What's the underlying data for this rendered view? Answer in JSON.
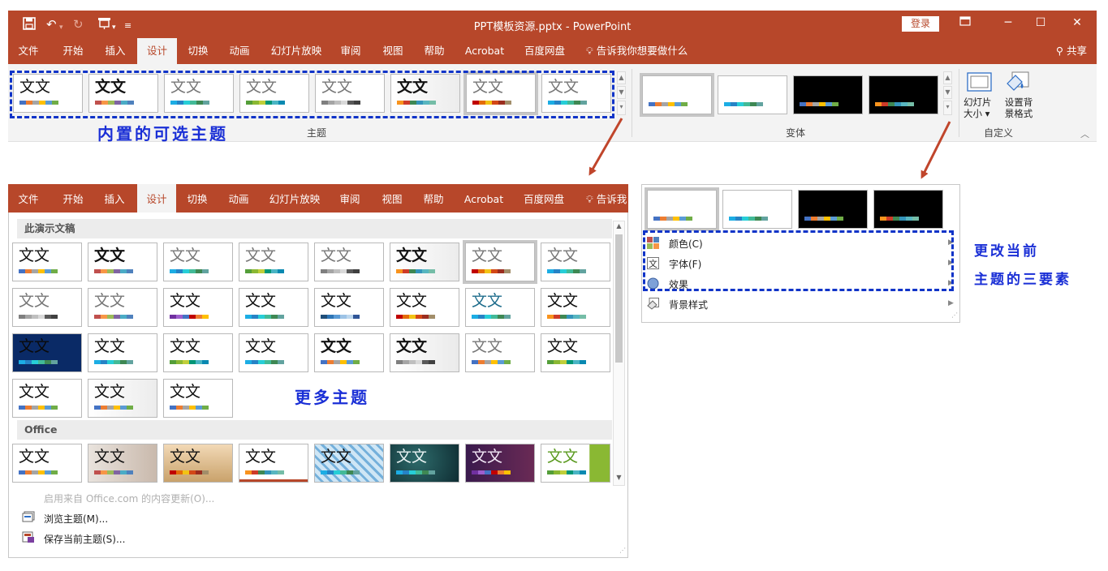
{
  "window": {
    "title": "PPT模板资源.pptx  -  PowerPoint",
    "login": "登录",
    "share": "共享",
    "quick_access": [
      "save-icon",
      "undo-icon",
      "redo-icon",
      "present-icon",
      "customize-icon"
    ]
  },
  "tabs": [
    "文件",
    "开始",
    "插入",
    "设计",
    "切换",
    "动画",
    "幻灯片放映",
    "审阅",
    "视图",
    "帮助",
    "Acrobat",
    "百度网盘"
  ],
  "active_tab": "设计",
  "tell_me": "告诉我你想要做什么",
  "tell_me_short": "告诉我",
  "ribbon": {
    "group_themes": "主题",
    "group_variants": "变体",
    "group_customize": "自定义",
    "slide_size": "幻灯片大小",
    "format_bg": "设置背景格式"
  },
  "thumb_text": "文文",
  "gallery": {
    "section_current": "此演示文稿",
    "section_office": "Office",
    "enable_updates": "启用来自 Office.com 的内容更新(O)...",
    "browse_themes": "浏览主题(M)...",
    "save_theme": "保存当前主题(S)..."
  },
  "variant_menu": {
    "colors": "颜色(C)",
    "fonts": "字体(F)",
    "effects": "效果",
    "bg_styles": "背景样式"
  },
  "annotations": {
    "builtin_themes": "内置的可选主题",
    "more_themes": "更多主题",
    "change_line1": "更改当前",
    "change_line2": "主题的三要素"
  },
  "colors": {
    "accent": "#b7472a",
    "annotation": "#1034c8"
  }
}
